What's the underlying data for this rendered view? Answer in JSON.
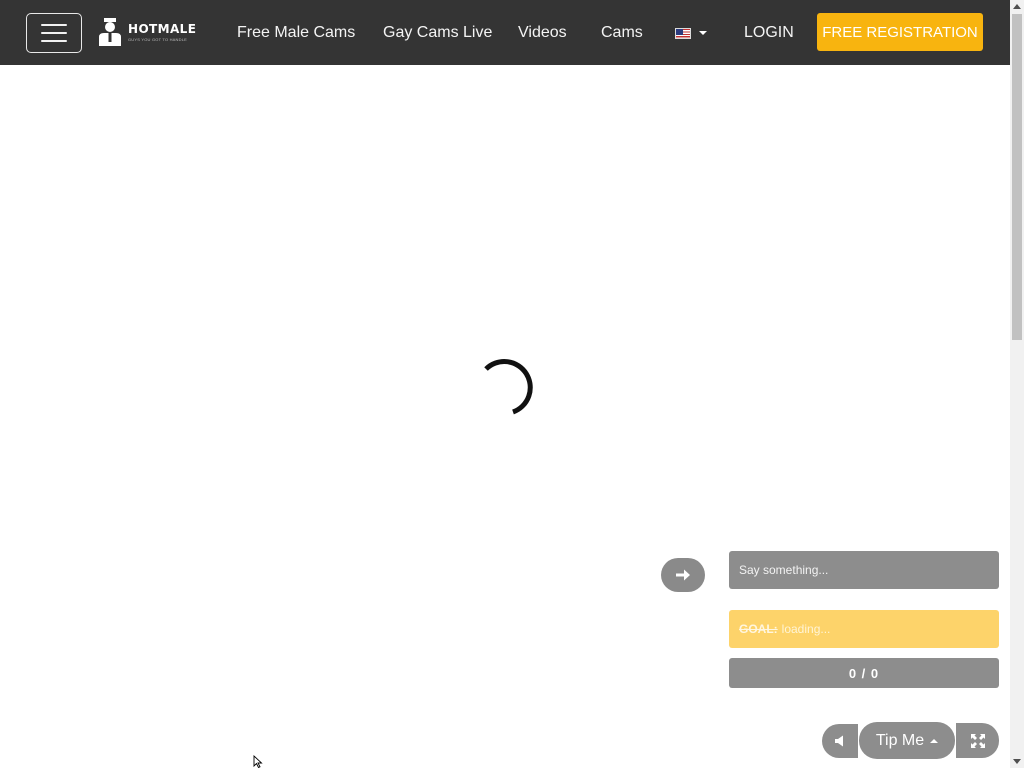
{
  "header": {
    "logo": {
      "name": "HOTMALE",
      "tagline": "GUYS YOU GOT TO HANDLE"
    },
    "nav": [
      {
        "label": "Free Male Cams"
      },
      {
        "label": "Gay Cams Live"
      },
      {
        "label": "Videos"
      },
      {
        "label": "Cams"
      }
    ],
    "language": {
      "icon": "us-flag-icon"
    },
    "login_label": "LOGIN",
    "register_label": "FREE REGISTRATION"
  },
  "player": {
    "loading_icon": "spinner-icon"
  },
  "chat": {
    "placeholder": "Say something...",
    "send_icon": "arrow-right-icon"
  },
  "goal": {
    "label": "GOAL:",
    "status": "loading..."
  },
  "progress": {
    "text": "0 / 0"
  },
  "controls": {
    "mute_icon": "volume-icon",
    "tip_label": "Tip Me",
    "fullscreen_icon": "fullscreen-icon"
  },
  "colors": {
    "header_bg": "#343434",
    "accent": "#f8b40f",
    "goal_bg": "#fdd36a",
    "control_gray": "#8d8d8d"
  }
}
